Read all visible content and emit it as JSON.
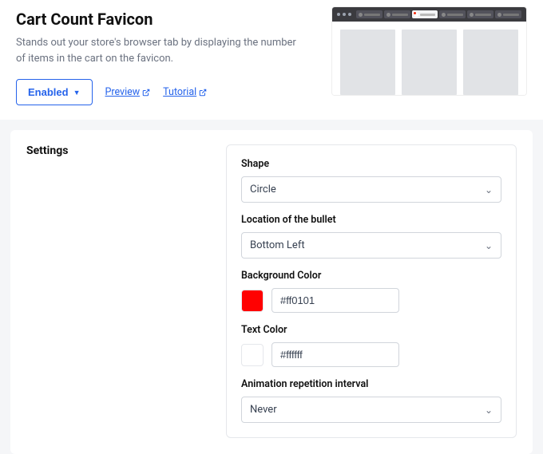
{
  "header": {
    "title": "Cart Count Favicon",
    "description": "Stands out your store's browser tab by displaying the number of items in the cart on the favicon.",
    "enabled_label": "Enabled",
    "preview_label": "Preview",
    "tutorial_label": "Tutorial"
  },
  "settings": {
    "heading": "Settings",
    "shape": {
      "label": "Shape",
      "value": "Circle"
    },
    "location": {
      "label": "Location of the bullet",
      "value": "Bottom Left"
    },
    "bg_color": {
      "label": "Background Color",
      "value": "#ff0101"
    },
    "text_color": {
      "label": "Text Color",
      "value": "#ffffff"
    },
    "interval": {
      "label": "Animation repetition interval",
      "value": "Never"
    }
  }
}
